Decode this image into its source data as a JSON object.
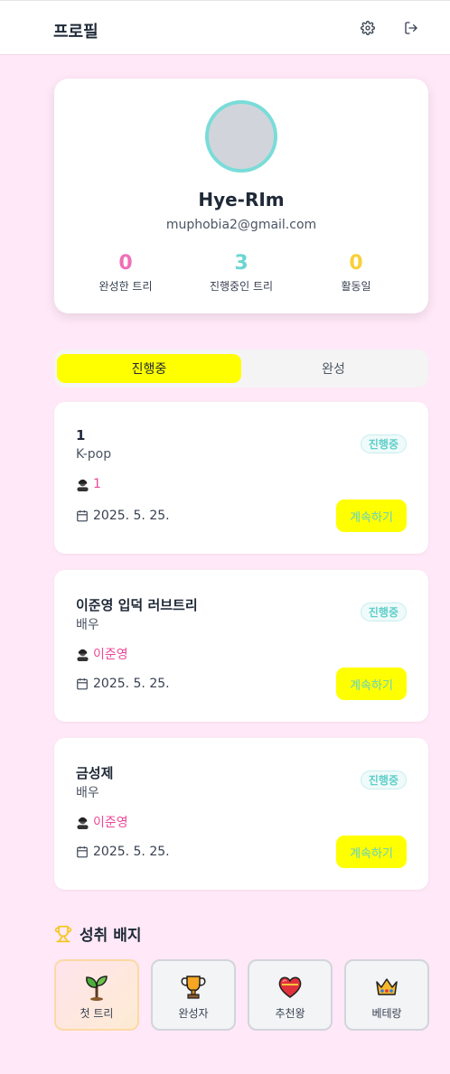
{
  "header": {
    "title": "프로필"
  },
  "profile": {
    "name": "Hye-RIm",
    "email": "muphobia2@gmail.com",
    "stats": [
      {
        "value": "0",
        "label": "완성한 트리",
        "color": "#f06fb7"
      },
      {
        "value": "3",
        "label": "진행중인 트리",
        "color": "#6dd5d1"
      },
      {
        "value": "0",
        "label": "활동일",
        "color": "#f9cf3a"
      }
    ]
  },
  "tabs": [
    {
      "label": "진행중",
      "active": true
    },
    {
      "label": "완성",
      "active": false
    }
  ],
  "trees": [
    {
      "title": "1",
      "category": "K-pop",
      "badge": "진행중",
      "person": "1",
      "date": "2025. 5. 25.",
      "action": "계속하기"
    },
    {
      "title": "이준영 입덕 러브트리",
      "category": "배우",
      "badge": "진행중",
      "person": "이준영",
      "date": "2025. 5. 25.",
      "action": "계속하기"
    },
    {
      "title": "금성제",
      "category": "배우",
      "badge": "진행중",
      "person": "이준영",
      "date": "2025. 5. 25.",
      "action": "계속하기"
    }
  ],
  "achievements": {
    "title": "성취 배지",
    "badges": [
      {
        "label": "첫 트리",
        "icon": "sprout-icon",
        "glyph": "🌱",
        "earned": true
      },
      {
        "label": "완성자",
        "icon": "trophy-icon",
        "glyph": "🏆",
        "earned": false
      },
      {
        "label": "추천왕",
        "icon": "heart-icon",
        "glyph": "❤",
        "earned": false
      },
      {
        "label": "베테랑",
        "icon": "crown-icon",
        "glyph": "♛",
        "earned": false
      }
    ]
  },
  "colors": {
    "accent_yellow": "#ffff00",
    "accent_teal": "#6dd5d1",
    "accent_pink": "#ec4899",
    "background": "#ffe8f7"
  }
}
